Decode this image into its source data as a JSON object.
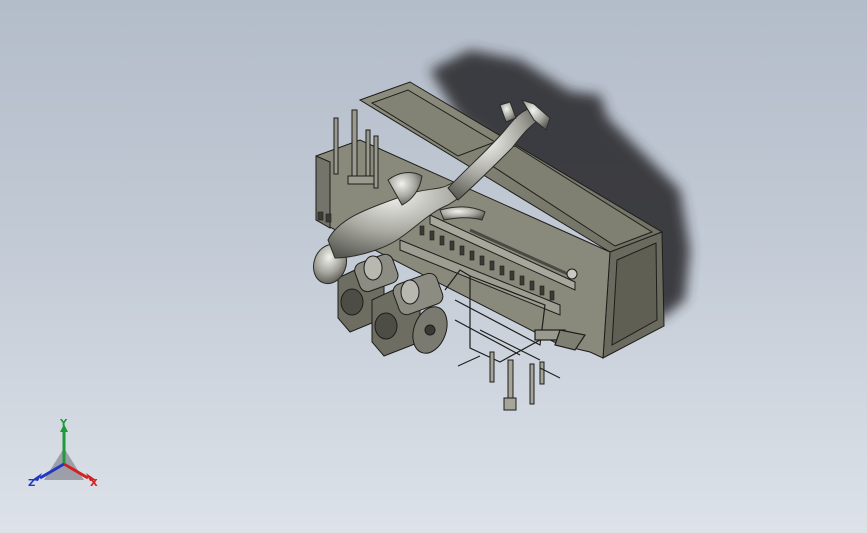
{
  "viewport": {
    "background_top": "#b3bcc9",
    "background_bottom": "#dde2e9"
  },
  "model": {
    "body_color": "#7d7d6f",
    "shadow_color": "#2d2e30",
    "figure_color": "#b9b9b3",
    "line_color": "#1d1d1b"
  },
  "triad": {
    "x_label": "X",
    "y_label": "Y",
    "z_label": "Z",
    "x_color": "#d42020",
    "y_color": "#1e9a3a",
    "z_color": "#2236c4"
  }
}
